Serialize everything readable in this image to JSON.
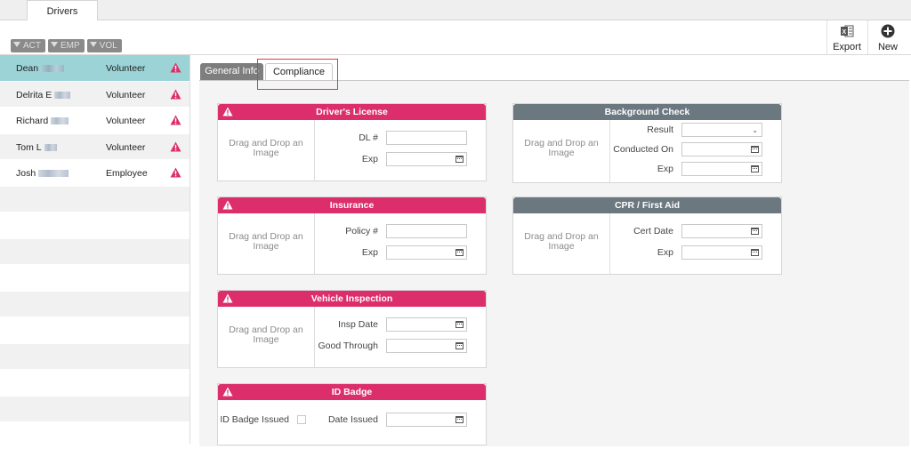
{
  "app": {
    "main_tab": "Drivers"
  },
  "toolbar": {
    "export_label": "Export",
    "new_label": "New"
  },
  "filters": [
    "ACT",
    "EMP",
    "VOL"
  ],
  "drivers": [
    {
      "name": "Dean",
      "type": "Volunteer"
    },
    {
      "name": "Delrita E",
      "type": "Volunteer"
    },
    {
      "name": "Richard",
      "type": "Volunteer"
    },
    {
      "name": "Tom L",
      "type": "Volunteer"
    },
    {
      "name": "Josh",
      "type": "Employee"
    }
  ],
  "tabs": {
    "general": "General Info",
    "compliance": "Compliance"
  },
  "drop_text": "Drag and Drop an Image",
  "cards": {
    "license": {
      "title": "Driver's License",
      "dl_label": "DL #",
      "exp_label": "Exp"
    },
    "insurance": {
      "title": "Insurance",
      "policy_label": "Policy #",
      "exp_label": "Exp"
    },
    "inspection": {
      "title": "Vehicle Inspection",
      "insp_label": "Insp Date",
      "good_label": "Good Through"
    },
    "badge": {
      "title": "ID Badge",
      "issued_label": "ID Badge Issued",
      "date_label": "Date Issued"
    },
    "background": {
      "title": "Background Check",
      "result_label": "Result",
      "conducted_label": "Conducted On",
      "exp_label": "Exp"
    },
    "cpr": {
      "title": "CPR / First Aid",
      "cert_label": "Cert Date",
      "exp_label": "Exp"
    }
  },
  "colors": {
    "pink_header": "#dc2e6a",
    "slate_header": "#6b7880",
    "selected_row": "#9bd3d6"
  }
}
